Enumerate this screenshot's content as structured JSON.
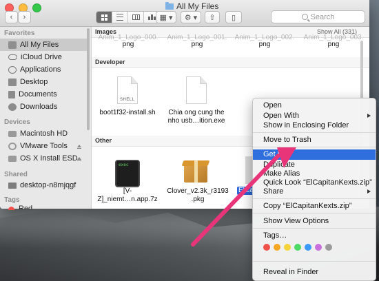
{
  "window": {
    "title": "All My Files",
    "search_placeholder": "Search"
  },
  "sidebar": {
    "favorites_header": "Favorites",
    "favorites": [
      {
        "label": "All My Files",
        "icon": "all-files-icon",
        "selected": true
      },
      {
        "label": "iCloud Drive",
        "icon": "cloud-icon"
      },
      {
        "label": "Applications",
        "icon": "applications-icon"
      },
      {
        "label": "Desktop",
        "icon": "desktop-icon"
      },
      {
        "label": "Documents",
        "icon": "documents-icon"
      },
      {
        "label": "Downloads",
        "icon": "downloads-icon"
      }
    ],
    "devices_header": "Devices",
    "devices": [
      {
        "label": "Macintosh HD",
        "icon": "hard-disk-icon"
      },
      {
        "label": "VMware Tools",
        "icon": "disc-icon",
        "eject": true
      },
      {
        "label": "OS X Install ESD",
        "icon": "disk-icon",
        "eject": true
      }
    ],
    "shared_header": "Shared",
    "shared": [
      {
        "label": "desktop-n8mjqgf",
        "icon": "display-icon"
      }
    ],
    "tags_header": "Tags",
    "tags": [
      {
        "label": "Red",
        "color": "#f0504a"
      }
    ]
  },
  "content": {
    "images_section": "Images",
    "show_all": "Show All (331)",
    "image_files": [
      {
        "line1": "Anim_1_Logo_000.",
        "line2": "png"
      },
      {
        "line1": "Anim_1_Logo_001.",
        "line2": "png"
      },
      {
        "line1": "Anim_1_Logo_002.",
        "line2": "png"
      },
      {
        "line1": "Anim_1_Logo_003.",
        "line2": "png"
      }
    ],
    "developer_section": "Developer",
    "developer_files": [
      {
        "line1": "boot1f32-install.sh",
        "line2": "",
        "icon": "shell-script-icon",
        "icon_label": "SHELL"
      },
      {
        "line1": "Chia ong cung the",
        "line2": "nho usb…ition.exe",
        "icon": "document-icon"
      }
    ],
    "other_section": "Other",
    "other_files": [
      {
        "line1": "[V-",
        "line2": "Z]_niemt…n.app.7z",
        "icon": "exec-icon",
        "icon_label": "exec"
      },
      {
        "line1": "Clover_v2.3k_r3193",
        "line2": ".pkg",
        "icon": "package-icon"
      },
      {
        "line1": "ElCa",
        "line2": "",
        "icon": "zip-icon",
        "selected": true
      }
    ]
  },
  "context_menu": {
    "items": [
      {
        "label": "Open"
      },
      {
        "label": "Open With",
        "submenu": true
      },
      {
        "label": "Show in Enclosing Folder"
      },
      {
        "label": "Move to Trash"
      },
      {
        "label": "Get Info",
        "highlighted": true
      },
      {
        "label": "Duplicate"
      },
      {
        "label": "Make Alias"
      },
      {
        "label": "Quick Look “ElCapitanKexts.zip”"
      },
      {
        "label": "Share",
        "submenu": true
      },
      {
        "label": "Copy “ElCapitanKexts.zip”"
      },
      {
        "label": "Show View Options"
      },
      {
        "label": "Tags…"
      },
      {
        "label": "Reveal in Finder"
      }
    ],
    "tag_colors": [
      "#f0504a",
      "#f5a623",
      "#f5d33a",
      "#4cd964",
      "#3b99fc",
      "#c86fdc",
      "#9b9b9b"
    ]
  },
  "annotation": {
    "color": "#e8357a"
  }
}
